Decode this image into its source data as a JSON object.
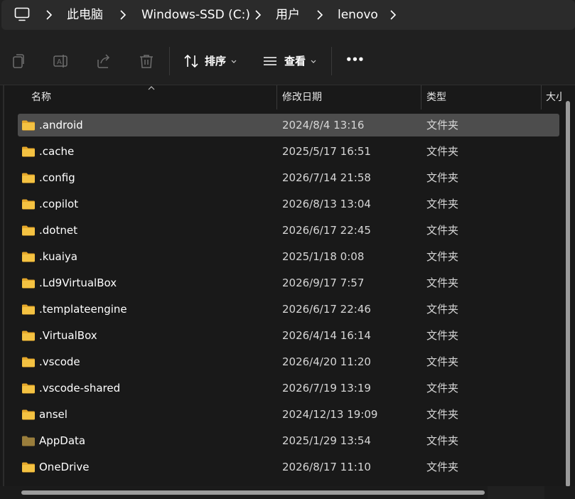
{
  "breadcrumb": {
    "items": [
      "此电脑",
      "Windows-SSD (C:)",
      "用户",
      "lenovo"
    ]
  },
  "toolbar": {
    "sort_label": "排序",
    "view_label": "查看",
    "more_label": "•••"
  },
  "columns": {
    "name": "名称",
    "modified": "修改日期",
    "type": "类型",
    "size": "大小"
  },
  "files": [
    {
      "name": ".android",
      "modified": "2024/8/4 13:16",
      "type": "文件夹",
      "selected": true
    },
    {
      "name": ".cache",
      "modified": "2025/5/17 16:51",
      "type": "文件夹"
    },
    {
      "name": ".config",
      "modified": "2026/7/14 21:58",
      "type": "文件夹"
    },
    {
      "name": ".copilot",
      "modified": "2026/8/13 13:04",
      "type": "文件夹"
    },
    {
      "name": ".dotnet",
      "modified": "2026/6/17 22:45",
      "type": "文件夹"
    },
    {
      "name": ".kuaiya",
      "modified": "2025/1/18 0:08",
      "type": "文件夹"
    },
    {
      "name": ".Ld9VirtualBox",
      "modified": "2026/9/17 7:57",
      "type": "文件夹"
    },
    {
      "name": ".templateengine",
      "modified": "2026/6/17 22:46",
      "type": "文件夹"
    },
    {
      "name": ".VirtualBox",
      "modified": "2026/4/14 16:14",
      "type": "文件夹"
    },
    {
      "name": ".vscode",
      "modified": "2026/4/20 11:20",
      "type": "文件夹"
    },
    {
      "name": ".vscode-shared",
      "modified": "2026/7/19 13:19",
      "type": "文件夹"
    },
    {
      "name": "ansel",
      "modified": "2024/12/13 19:09",
      "type": "文件夹"
    },
    {
      "name": "AppData",
      "modified": "2025/1/29 13:54",
      "type": "文件夹",
      "hidden_style": true
    },
    {
      "name": "OneDrive",
      "modified": "2026/8/17 11:10",
      "type": "文件夹"
    }
  ],
  "colors": {
    "folder": "#f4c242",
    "folder_dark": "#e5a82a",
    "folder_hidden": "#9a7e3c",
    "selected_row": "#4d4d4d"
  }
}
